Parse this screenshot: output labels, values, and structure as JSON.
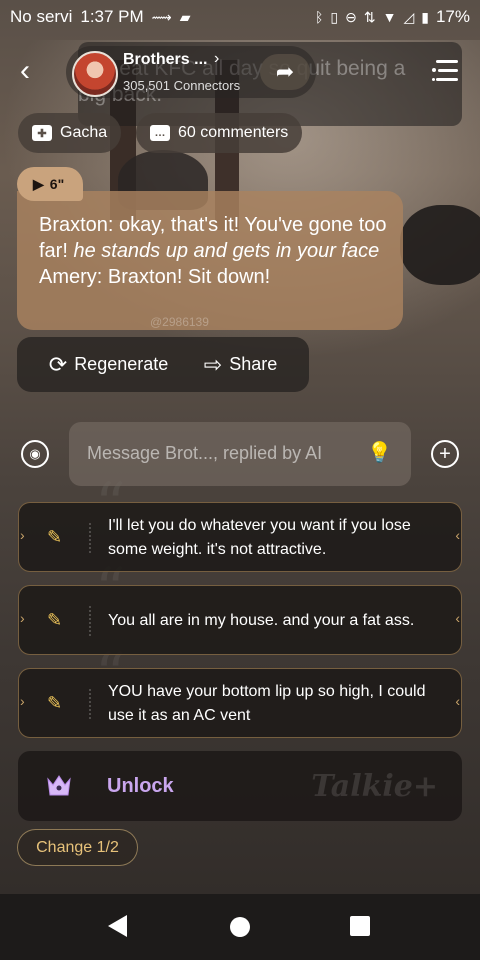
{
  "status_bar": {
    "carrier": "No servi",
    "time": "1:37 PM",
    "battery": "17%",
    "icons": [
      "activity-icon",
      "sim-icon",
      "bluetooth-icon",
      "vibrate-icon",
      "dnd-icon",
      "data-icon",
      "wifi-icon",
      "signal-icon",
      "battery-icon"
    ]
  },
  "header": {
    "character_name": "Brothers ...",
    "connectors": "305,501 Connectors",
    "background_text": "You eat KFC all day so quit being a big back."
  },
  "chips": [
    {
      "label": "Gacha",
      "icon": "gacha-icon"
    },
    {
      "label": "60 commenters",
      "icon": "comments-icon"
    }
  ],
  "message": {
    "audio_duration": "6\"",
    "speaker1": "Braxton: okay, that's it! You've gone too far! ",
    "action": "he stands up and gets in your face",
    "speaker2": " Amery: Braxton! Sit down!",
    "watermark": "@2986139"
  },
  "actions": {
    "regenerate": "Regenerate",
    "share": "Share"
  },
  "input": {
    "placeholder": "Message Brot..., replied by AI"
  },
  "suggestions": [
    "I'll let you do whatever you want if you lose some weight. it's not attractive.",
    "You all are in my house. and your a fat ass.",
    "YOU have your bottom lip up so high, I could use it as an AC vent"
  ],
  "unlock": {
    "label": "Unlock",
    "brand": "Talkie+"
  },
  "change_button": "Change 1/2",
  "colors": {
    "bubble": "#aa825f",
    "unlock_text": "#c9a6ee",
    "change_text": "#e7c27a",
    "bulb": "#e8b93a"
  }
}
